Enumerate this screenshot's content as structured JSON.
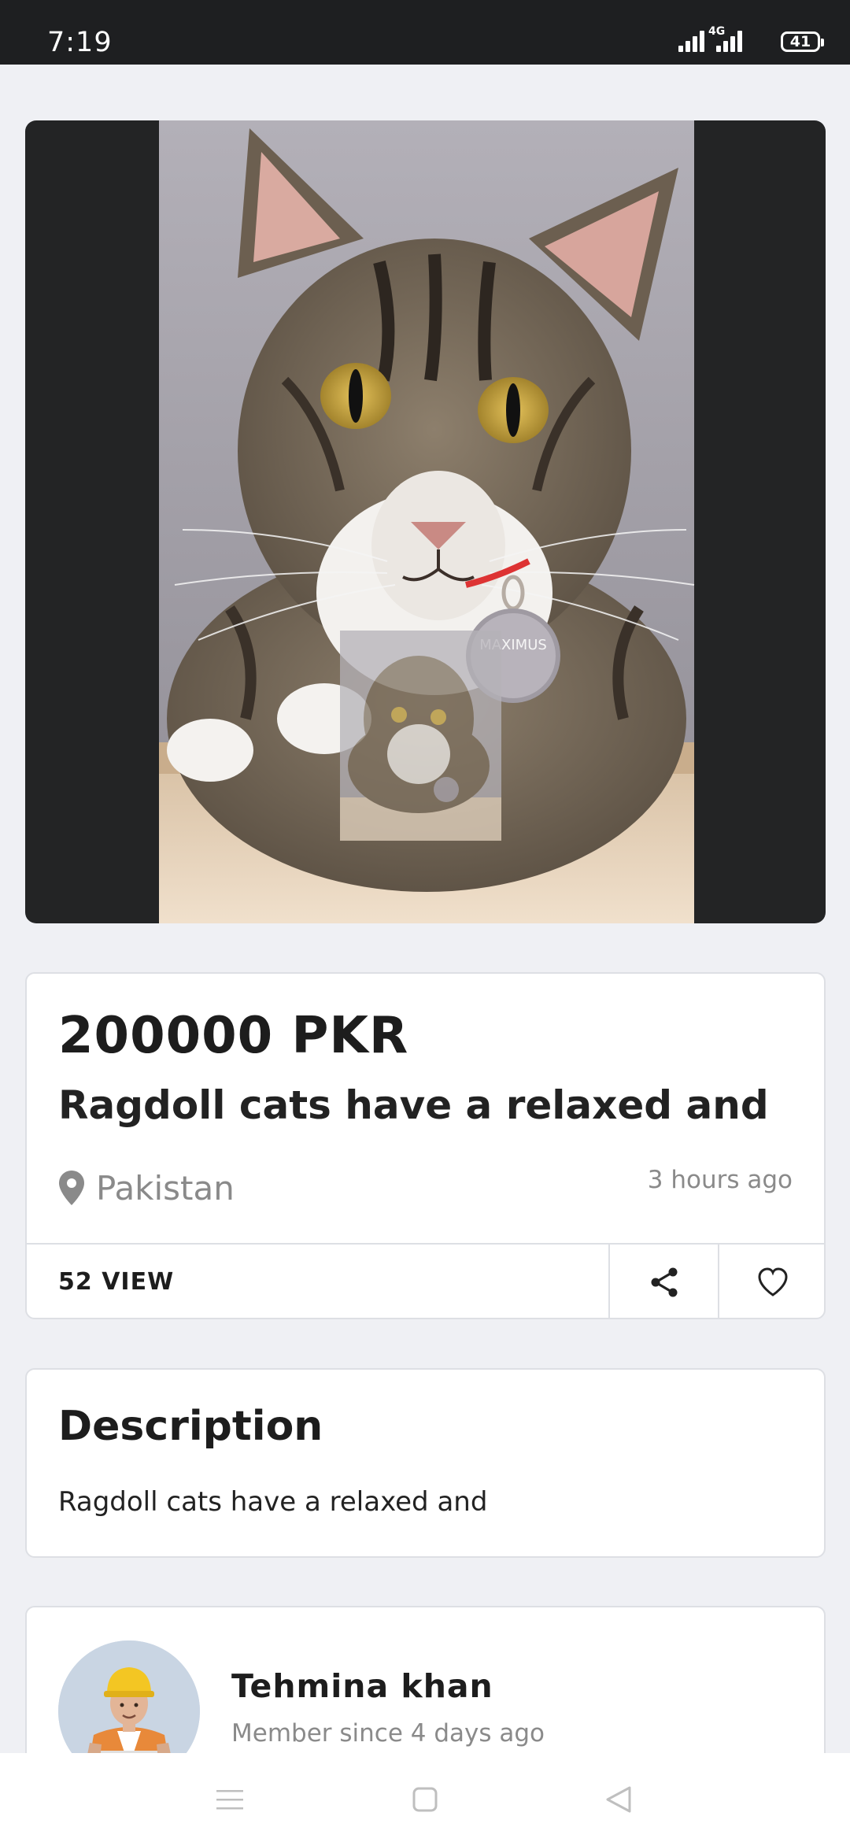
{
  "status_bar": {
    "time": "7:19",
    "network": "4G",
    "battery": "41"
  },
  "hero": {
    "collar_tag_text": "MAXIMUS"
  },
  "listing": {
    "price": "200000 PKR",
    "title": "Ragdoll cats have a relaxed and",
    "location": "Pakistan",
    "posted": "3 hours ago",
    "views": "52 VIEW"
  },
  "description": {
    "heading": "Description",
    "text": "Ragdoll cats have a relaxed and"
  },
  "seller": {
    "name": "Tehmina khan",
    "member_since": "Member since 4 days ago"
  },
  "icons": {
    "location": "map-pin-icon",
    "share": "share-icon",
    "favorite": "heart-icon",
    "nav_menu": "menu-icon",
    "nav_home": "home-square-icon",
    "nav_back": "back-triangle-icon"
  }
}
